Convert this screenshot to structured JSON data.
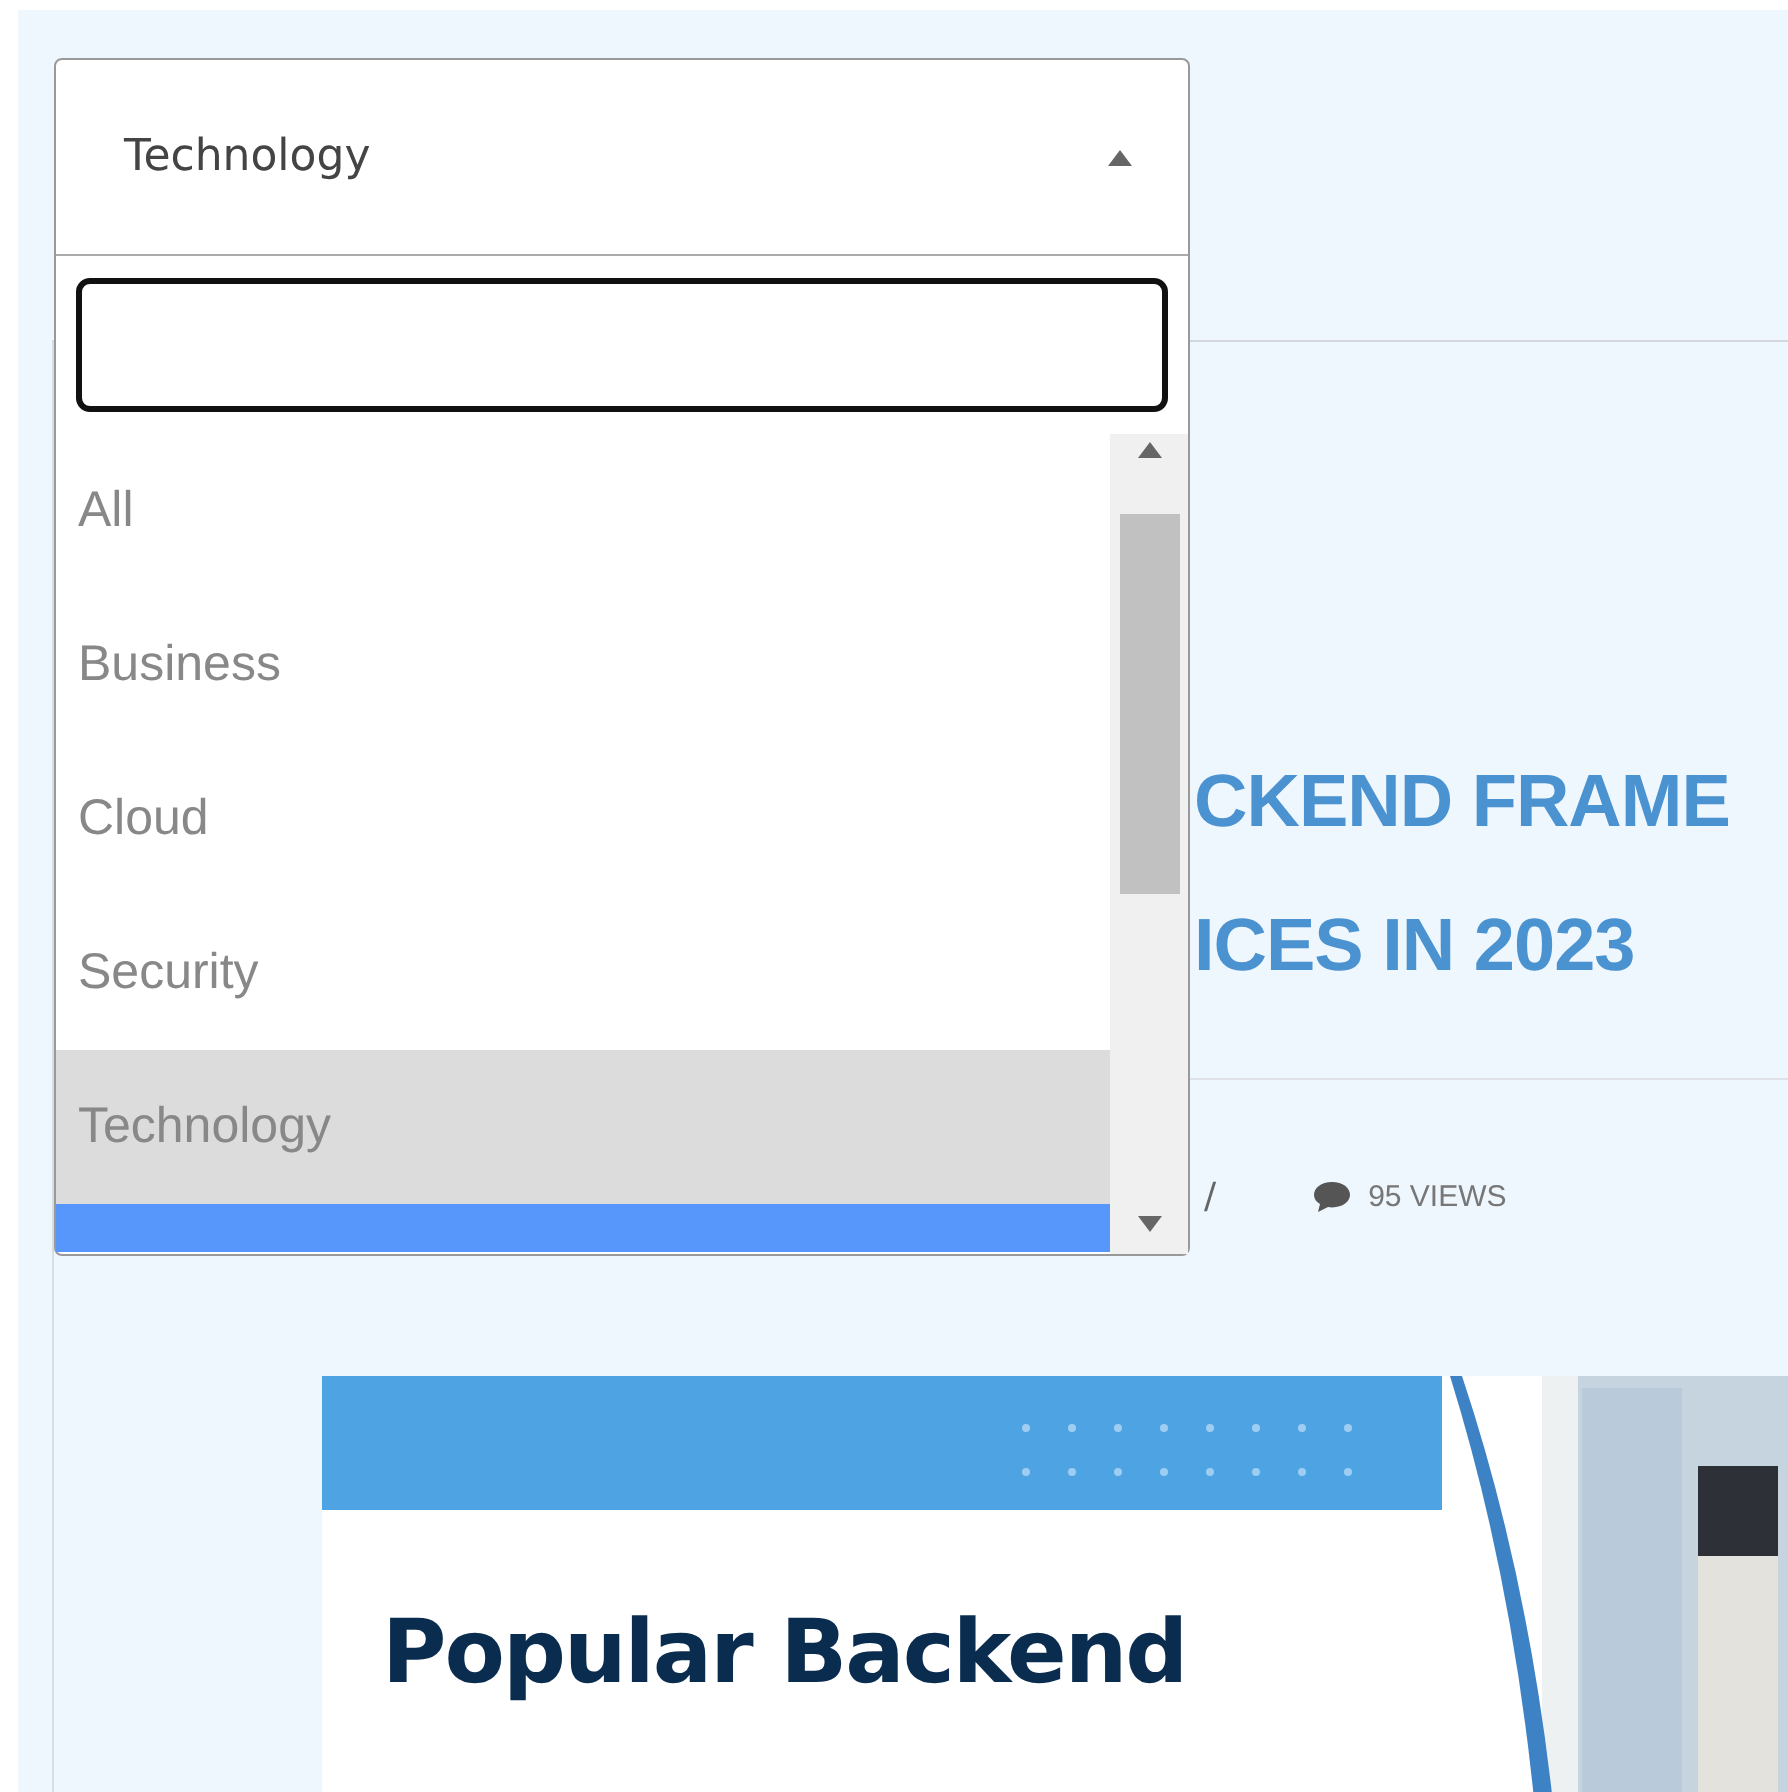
{
  "dropdown": {
    "value": "Technology",
    "expanded": true,
    "options": [
      {
        "label": "All",
        "selected": false
      },
      {
        "label": "Business",
        "selected": false
      },
      {
        "label": "Cloud",
        "selected": false
      },
      {
        "label": "Security",
        "selected": false
      },
      {
        "label": "Technology",
        "selected": true
      }
    ]
  },
  "article": {
    "title_lines": [
      "CKEND FRAME",
      "ICES IN 2023"
    ],
    "meta": {
      "separator": "/",
      "views": "95 VIEWS"
    },
    "banner": {
      "heading": "Popular Backend"
    }
  }
}
